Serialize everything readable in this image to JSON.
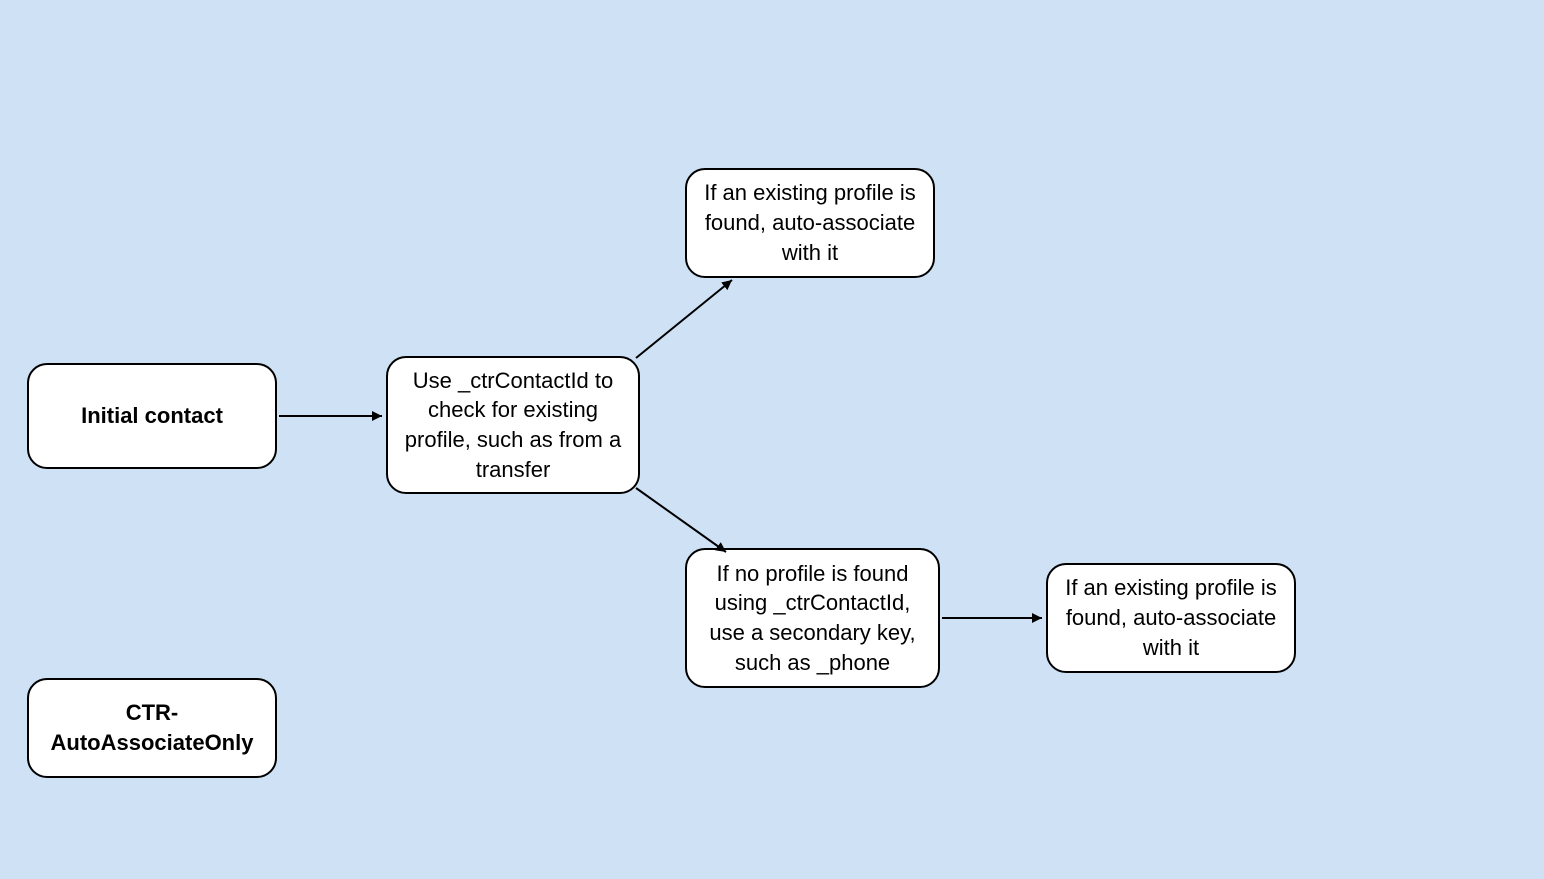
{
  "nodes": {
    "initial_contact": "Initial contact",
    "check_profile": "Use _ctrContactId to check for existing profile, such as from a transfer",
    "found_top": "If an existing profile is found, auto-associate with it",
    "no_profile": "If no profile is found using _ctrContactId, use a secondary key, such as _phone",
    "found_right": "If an existing profile is found, auto-associate with it",
    "ctr_label": "CTR-AutoAssociateOnly"
  }
}
